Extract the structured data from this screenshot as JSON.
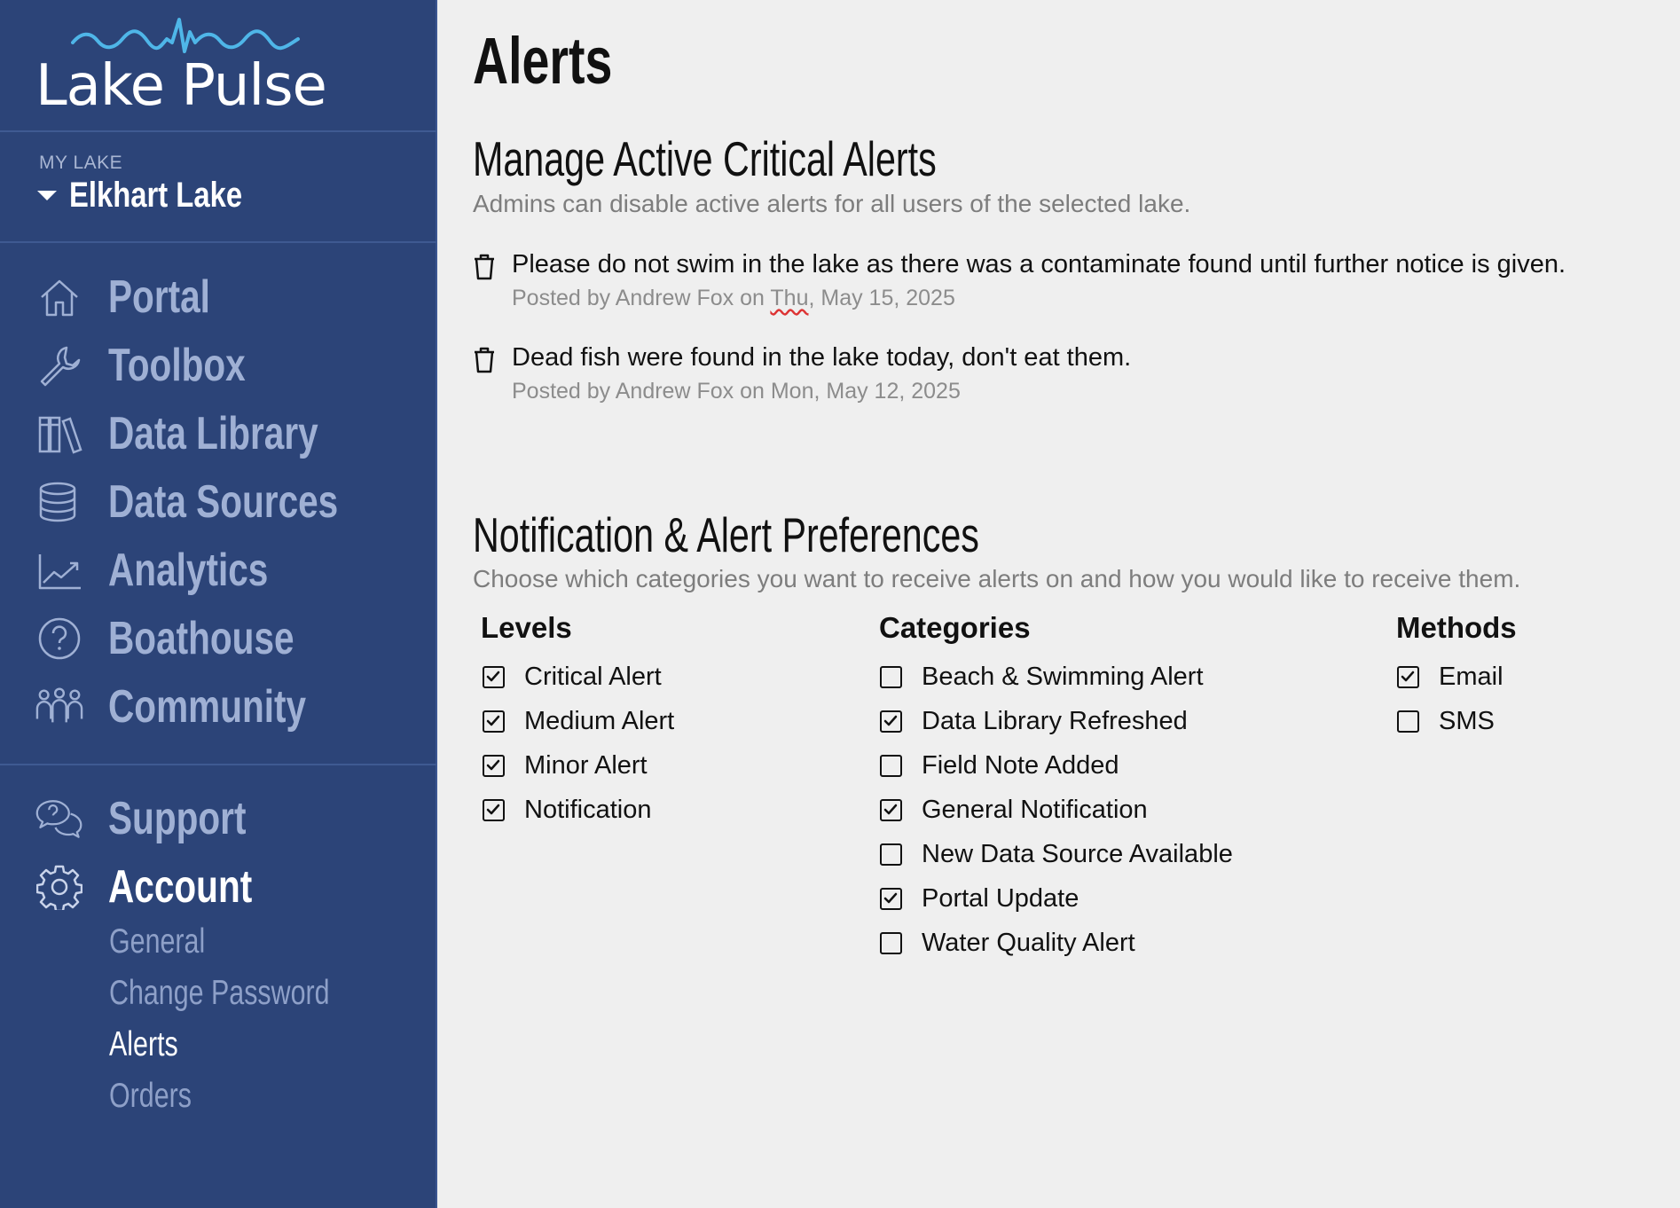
{
  "brand": {
    "name": "Lake Pulse"
  },
  "lake": {
    "label": "MY LAKE",
    "name": "Elkhart Lake"
  },
  "nav": [
    {
      "label": "Portal",
      "icon": "home-icon"
    },
    {
      "label": "Toolbox",
      "icon": "wrench-icon"
    },
    {
      "label": "Data Library",
      "icon": "books-icon"
    },
    {
      "label": "Data Sources",
      "icon": "database-icon"
    },
    {
      "label": "Analytics",
      "icon": "chart-line-icon"
    },
    {
      "label": "Boathouse",
      "icon": "question-circle-icon"
    },
    {
      "label": "Community",
      "icon": "people-icon"
    }
  ],
  "nav2": [
    {
      "label": "Support",
      "icon": "chat-question-icon"
    },
    {
      "label": "Account",
      "icon": "gear-icon",
      "active": true
    }
  ],
  "account_sub": [
    {
      "label": "General"
    },
    {
      "label": "Change Password"
    },
    {
      "label": "Alerts",
      "active": true
    },
    {
      "label": "Orders"
    }
  ],
  "page": {
    "title": "Alerts"
  },
  "manage": {
    "title": "Manage Active Critical Alerts",
    "subtitle": "Admins can disable active alerts for all users of the selected lake.",
    "alerts": [
      {
        "message": "Please do not swim in the lake as there was a contaminate found until further notice is given.",
        "meta_prefix": "Posted by Andrew Fox on ",
        "meta_day": "Thu",
        "meta_suffix": ", May 15, 2025"
      },
      {
        "message": "Dead fish were found in the lake today, don't eat them.",
        "meta_prefix": "Posted by Andrew Fox on ",
        "meta_day": "Mon",
        "meta_suffix": ", May 12, 2025"
      }
    ]
  },
  "prefs": {
    "title": "Notification & Alert Preferences",
    "subtitle": "Choose which categories you want to receive alerts on and how you would like to receive them.",
    "levels": {
      "heading": "Levels",
      "items": [
        {
          "label": "Critical Alert",
          "checked": true
        },
        {
          "label": "Medium Alert",
          "checked": true
        },
        {
          "label": "Minor Alert",
          "checked": true
        },
        {
          "label": "Notification",
          "checked": true
        }
      ]
    },
    "categories": {
      "heading": "Categories",
      "items": [
        {
          "label": "Beach & Swimming Alert",
          "checked": false
        },
        {
          "label": "Data Library Refreshed",
          "checked": true
        },
        {
          "label": "Field Note Added",
          "checked": false
        },
        {
          "label": "General Notification",
          "checked": true
        },
        {
          "label": "New Data Source Available",
          "checked": false
        },
        {
          "label": "Portal Update",
          "checked": true
        },
        {
          "label": "Water Quality Alert",
          "checked": false
        }
      ]
    },
    "methods": {
      "heading": "Methods",
      "items": [
        {
          "label": "Email",
          "checked": true
        },
        {
          "label": "SMS",
          "checked": false
        }
      ]
    }
  },
  "colors": {
    "sidebar": "#2c4478",
    "nav_text": "#9fb0d4",
    "accent": "#4fb6e8",
    "background": "#efefef"
  }
}
